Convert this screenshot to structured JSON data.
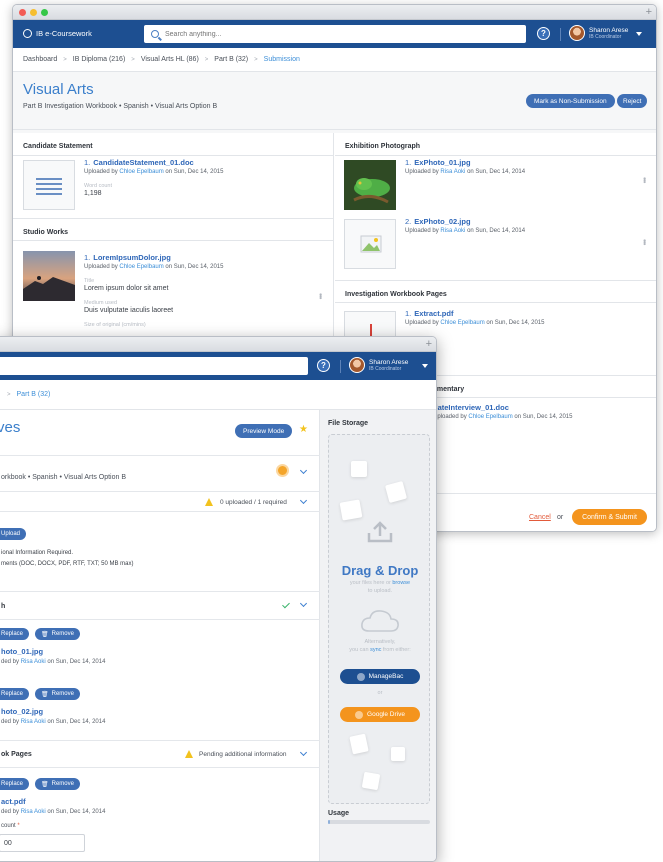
{
  "app": {
    "name": "IB e-Coursework"
  },
  "search": {
    "placeholder": "Search anything..."
  },
  "user": {
    "name": "Sharon Arese",
    "role": "IB Coordinator"
  },
  "breadcrumb": [
    "Dashboard",
    "IB Diploma (216)",
    "Visual Arts HL (86)",
    "Part B (32)",
    "Submission"
  ],
  "breadcrumb_w2": [
    "Part B (32)"
  ],
  "page": {
    "title": "Visual Arts",
    "subtitle": "Part B Investigation Workbook  •  Spanish  •  Visual Arts Option B",
    "mark_button": "Mark as Non-Submission",
    "reject_button": "Reject"
  },
  "candidate_statement": {
    "heading": "Candidate Statement",
    "file": {
      "num": "1.",
      "name": "CandidateStatement_01.doc",
      "uploaded_prefix": "Uploaded by",
      "uploader": "Chloe Epelbaum",
      "date": "on Sun, Dec 14, 2015"
    },
    "word_count_label": "Word count",
    "word_count": "1,198"
  },
  "studio_works": {
    "heading": "Studio Works",
    "file": {
      "num": "1.",
      "name": "LoremIpsumDolor.jpg",
      "uploaded_prefix": "Uploaded by",
      "uploader": "Chloe Epelbaum",
      "date": "on Sun, Dec 14, 2015"
    },
    "title_label": "Title",
    "title_value": "Lorem ipsum dolor sit amet",
    "medium_label": "Medium used",
    "medium_value": "Duis vulputate iaculis laoreet",
    "size_label": "Size of original (cm/mins)"
  },
  "exhibition": {
    "heading": "Exhibition Photograph",
    "files": [
      {
        "num": "1.",
        "name": "ExPhoto_01.jpg",
        "uploaded_prefix": "Uploaded by",
        "uploader": "Risa Aoki",
        "date": "on Sun, Dec 14, 2014"
      },
      {
        "num": "2.",
        "name": "ExPhoto_02.jpg",
        "uploaded_prefix": "Uploaded by",
        "uploader": "Risa Aoki",
        "date": "on Sun, Dec 14, 2014"
      }
    ]
  },
  "workbook": {
    "heading": "Investigation Workbook Pages",
    "file": {
      "num": "1.",
      "name": "Extract.pdf",
      "uploaded_prefix": "Uploaded by",
      "uploader": "Chloe Epelbaum",
      "date": "on Sun, Dec 14, 2015"
    }
  },
  "commentary": {
    "heading_partial": "amentary",
    "file_partial": "dateInterview_01.doc",
    "uploaded_prefix": "Uploaded by",
    "uploader": "Chloe Epelbaum",
    "date": "on Sun, Dec 14, 2015"
  },
  "footer": {
    "cancel": "Cancel",
    "or": "or",
    "confirm": "Confirm & Submit"
  },
  "w2": {
    "title_partial": "ves",
    "preview_button": "Preview Mode",
    "subtitle_partial": "orkbook  •  Spanish  •  Visual Arts Option B",
    "upload_status": "0 uploaded / 1 required",
    "upload_button": "Upload",
    "info_required": "ional Information Required.",
    "formats": "ments (DOC, DOCX, PDF, RTF, TXT; 50 MB max)",
    "section_photo": "h",
    "replace": "Replace",
    "remove": "Remove",
    "photo1_name": "hoto_01.jpg",
    "photo1_meta_prefix": "ded by",
    "photo1_uploader": "Risa Aoki",
    "photo1_date": "on Sun, Dec 14, 2014",
    "photo2_name": "hoto_02.jpg",
    "photo2_meta_prefix": "ded by",
    "photo2_uploader": "Risa Aoki",
    "photo2_date": "on Sun, Dec 14, 2014",
    "section_pages": "ok Pages",
    "pending": "Pending additional information",
    "pdf_name": "act.pdf",
    "pdf_meta_prefix": "ded by",
    "pdf_uploader": "Risa Aoki",
    "pdf_date": "on Sun, Dec 14, 2014",
    "count_label": "count",
    "count_value": "00"
  },
  "storage": {
    "heading": "File Storage",
    "drag_title": "Drag & Drop",
    "drag_line1_a": "your files here or",
    "drag_line1_link": "browse",
    "drag_line2": "to upload.",
    "alt_line1": "Alternatively,",
    "alt_line2_a": "you can",
    "alt_line2_link": "sync",
    "alt_line2_b": "from either:",
    "managebac": "ManageBac",
    "or": "or",
    "google_drive": "Google Drive",
    "usage_label": "Usage",
    "usage_fraction": 0.02,
    "colors": {
      "managebac": "#1d4f91",
      "google_drive": "#f4941d"
    }
  },
  "colors": {
    "navbar": "#1d4f91",
    "accent": "#3b7fcb",
    "orange": "#f4941d"
  }
}
